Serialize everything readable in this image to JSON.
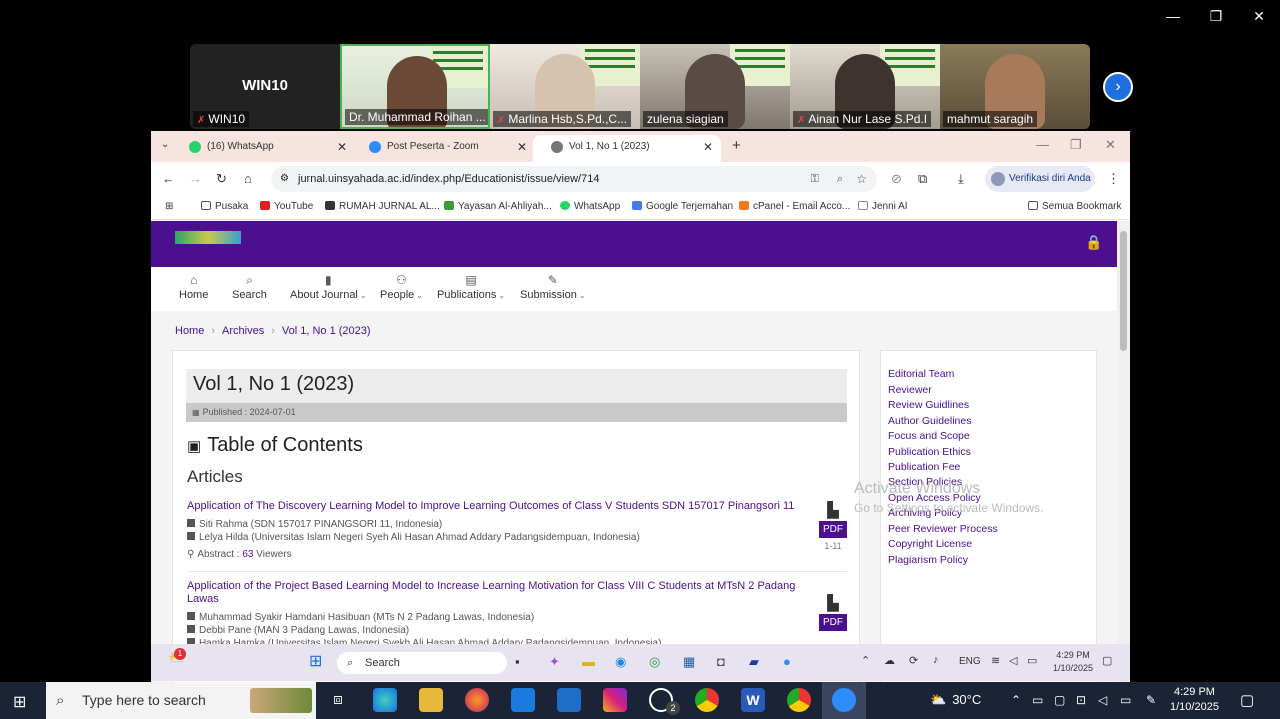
{
  "video": {
    "tiles": [
      {
        "name": "WIN10",
        "big": "WIN10"
      },
      {
        "name": "Dr. Muhammad Roihan ..."
      },
      {
        "name": "Marlina Hsb,S.Pd.,C..."
      },
      {
        "name": "zulena siagian"
      },
      {
        "name": "Ainan Nur Lase S.Pd.I"
      },
      {
        "name": "mahmut saragih"
      }
    ]
  },
  "browser": {
    "tabs": [
      {
        "label": "(16) WhatsApp",
        "color": "#25d366"
      },
      {
        "label": "Post Peserta - Zoom",
        "color": "#2d8cff"
      },
      {
        "label": "Vol 1, No 1 (2023)",
        "color": "#555555"
      }
    ],
    "url": "jurnal.uinsyahada.ac.id/index.php/Educationist/issue/view/714",
    "verify": "Verifikasi diri Anda",
    "bookmarks": [
      "Pusaka",
      "YouTube",
      "RUMAH JURNAL AL...",
      "Yayasan Al-Ahliyah...",
      "WhatsApp",
      "Google Terjemahan",
      "cPanel - Email Acco...",
      "Jenni AI"
    ],
    "all_bookmarks": "Semua Bookmark"
  },
  "site": {
    "nav": [
      {
        "label": "Home",
        "icon": "home-icon",
        "glyph": "⌂",
        "dd": false
      },
      {
        "label": "Search",
        "icon": "search-icon",
        "glyph": "⌕",
        "dd": false
      },
      {
        "label": "About Journal",
        "icon": "book-icon",
        "glyph": "▮",
        "dd": true
      },
      {
        "label": "People",
        "icon": "people-icon",
        "glyph": "⚇",
        "dd": true
      },
      {
        "label": "Publications",
        "icon": "document-icon",
        "glyph": "▤",
        "dd": true
      },
      {
        "label": "Submission",
        "icon": "edit-icon",
        "glyph": "✎",
        "dd": true
      }
    ],
    "breadcrumb": [
      "Home",
      "Archives",
      "Vol 1, No 1 (2023)"
    ],
    "issue_title": "Vol 1, No 1 (2023)",
    "published": "Published : 2024-07-01",
    "toc": "Table of Contents",
    "section": "Articles",
    "articles": [
      {
        "title": "Application of The Discovery Learning Model to Improve Learning Outcomes of Class V Students SDN 157017 Pinangsori 11",
        "authors": [
          "Siti Rahma (SDN 157017 PINANGSORI 11, Indonesia)",
          "Lelya Hilda (Universitas Islam Negeri Syeh Ali Hasan Ahmad Addary Padangsidempuan, Indonesia)"
        ],
        "abstract_label": "Abstract :",
        "views": "63",
        "views_label": "Viewers",
        "pdf": "PDF",
        "pages": "1-11"
      },
      {
        "title": "Application of the Project Based Learning Model to Increase Learning Motivation for Class VIII C Students at MTsN 2 Padang Lawas",
        "authors": [
          "Muhammad Syakir Hamdani Hasibuan (MTs N 2 Padang Lawas, Indonesia)",
          "Debbi Pane (MAN 3 Padang Lawas, Indonesia)",
          "Hamka Hamka (Universitas Islam Negeri Syekh Ali Hasan Ahmad Addary Padangsidempuan, Indonesia)"
        ],
        "pdf": "PDF"
      }
    ],
    "sidebar": [
      "Editorial Team",
      "Reviewer",
      "Review Guidlines",
      "Author Guidelines",
      "Focus and Scope",
      "Publication Ethics",
      "Publication Fee",
      "Section Policies",
      "Open Access Policy",
      "Archiving Policy",
      "Peer Reviewer Process",
      "Copyright License",
      "Plagiarism Policy"
    ]
  },
  "activate": {
    "title": "Activate Windows",
    "sub": "Go to Settings to activate Windows."
  },
  "inner_taskbar": {
    "search": "Search",
    "lang": "ENG",
    "time": "4:29 PM",
    "date": "1/10/2025",
    "badge": "1"
  },
  "taskbar": {
    "search": "Type here to search",
    "temp": "30°C",
    "time": "4:29 PM",
    "date": "1/10/2025",
    "wa_badge": "2"
  }
}
